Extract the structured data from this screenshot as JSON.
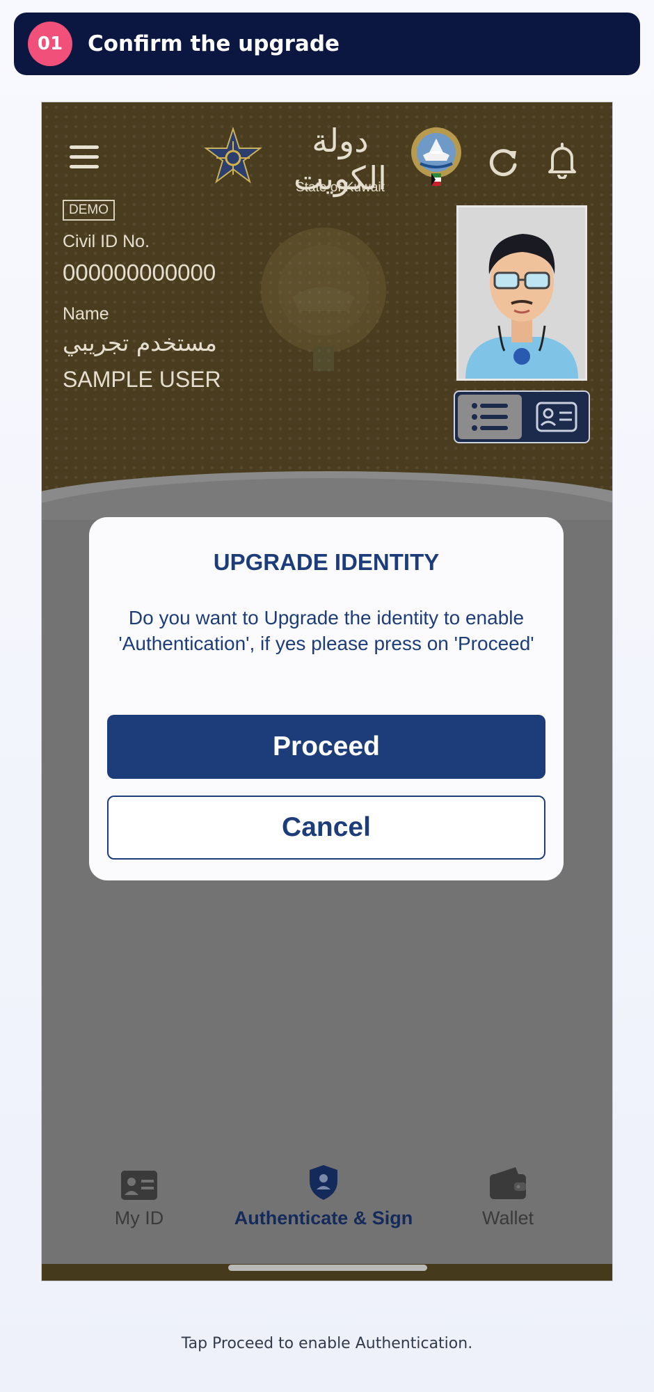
{
  "step": {
    "number": "01",
    "title": "Confirm the upgrade"
  },
  "header": {
    "arabic_title": "دولة الكويت",
    "state_name": "State of Kuwait",
    "demo_badge": "DEMO",
    "civil_id_label": "Civil ID No.",
    "civil_id_value": "000000000000",
    "name_label": "Name",
    "name_arabic": "مستخدم تجريبي",
    "name_english": "SAMPLE USER"
  },
  "modal": {
    "title": "UPGRADE IDENTITY",
    "message": "Do you want to Upgrade the identity to enable 'Authentication', if yes please press on 'Proceed'",
    "proceed_label": "Proceed",
    "cancel_label": "Cancel"
  },
  "nav": {
    "items": [
      {
        "label": "My ID",
        "icon": "id-card-icon",
        "active": false
      },
      {
        "label": "Authenticate & Sign",
        "icon": "shield-user-icon",
        "active": true
      },
      {
        "label": "Wallet",
        "icon": "wallet-icon",
        "active": false
      }
    ]
  },
  "caption": "Tap Proceed to enable Authentication.",
  "colors": {
    "banner": "#0b1740",
    "step_badge": "#f0507a",
    "header_bg": "#4a3d1f",
    "primary": "#1d3c7a",
    "overlay": "#737373"
  }
}
